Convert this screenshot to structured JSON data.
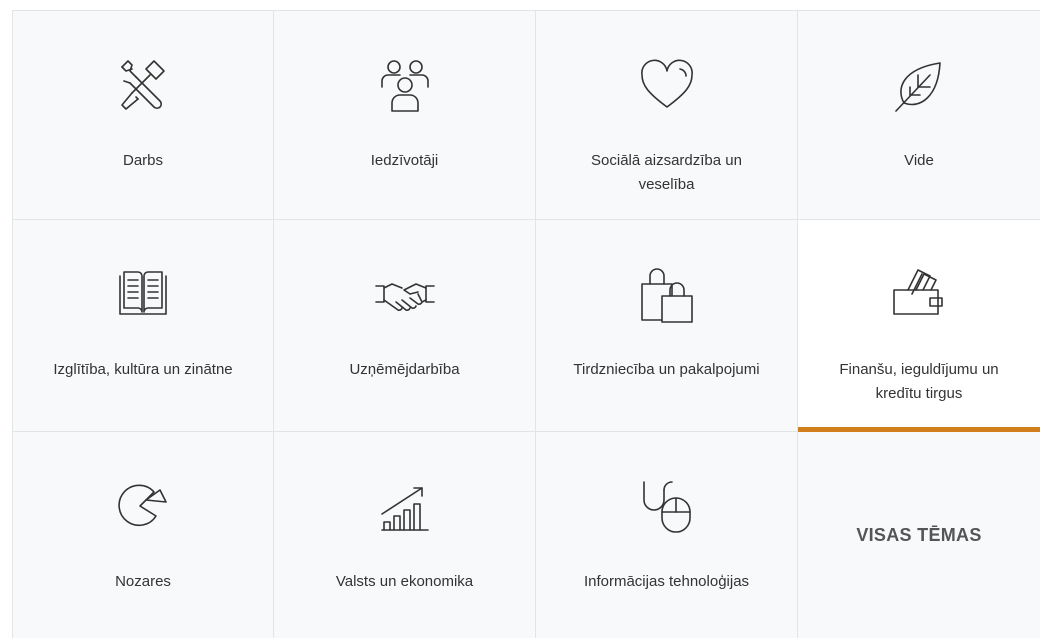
{
  "tiles": [
    {
      "label": "Darbs",
      "icon": "tools-icon"
    },
    {
      "label": "Iedzīvotāji",
      "icon": "people-icon"
    },
    {
      "label": "Sociālā aizsardzība un veselība",
      "icon": "heart-icon"
    },
    {
      "label": "Vide",
      "icon": "leaf-icon"
    },
    {
      "label": "Izglītība, kultūra un zinātne",
      "icon": "book-icon"
    },
    {
      "label": "Uzņēmējdarbība",
      "icon": "handshake-icon"
    },
    {
      "label": "Tirdzniecība un pakalpojumi",
      "icon": "shopping-bags-icon"
    },
    {
      "label": "Finanšu, ieguldījumu un kredītu tirgus",
      "icon": "wallet-icon",
      "active": true
    },
    {
      "label": "Nozares",
      "icon": "pie-chart-icon"
    },
    {
      "label": "Valsts un ekonomika",
      "icon": "growth-chart-icon"
    },
    {
      "label": "Informācijas tehnoloģijas",
      "icon": "mouse-cable-icon"
    }
  ],
  "all_topics_label": "VISAS TĒMAS",
  "colors": {
    "accent": "#d17f1d",
    "tile_bg": "#f7f9fa",
    "border": "#e1e5e8",
    "text": "#333333"
  }
}
